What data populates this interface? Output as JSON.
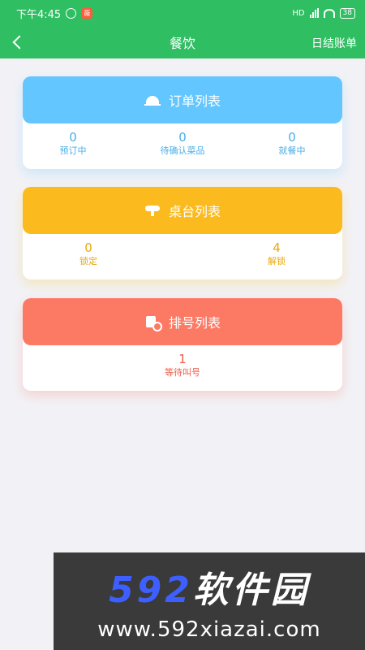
{
  "statusbar": {
    "time": "下午4:45",
    "app_badge": "薇",
    "network": "HD",
    "battery": "38"
  },
  "header": {
    "title": "餐饮",
    "right_action": "日结账单"
  },
  "cards": {
    "orders": {
      "title": "订单列表",
      "stats": [
        {
          "value": "0",
          "label": "预订中"
        },
        {
          "value": "0",
          "label": "待确认菜品"
        },
        {
          "value": "0",
          "label": "就餐中"
        }
      ]
    },
    "tables": {
      "title": "桌台列表",
      "stats": [
        {
          "value": "0",
          "label": "锁定"
        },
        {
          "value": "4",
          "label": "解锁"
        }
      ]
    },
    "queue": {
      "title": "排号列表",
      "stats": [
        {
          "value": "1",
          "label": "等待叫号"
        }
      ]
    }
  },
  "watermark": {
    "brand_num": "592",
    "brand_text": "软件园",
    "url": "www.592xiazai.com"
  },
  "colors": {
    "primary": "#2fbf62",
    "orders": "#63c6ff",
    "tables": "#fbbb1e",
    "queue": "#fc7a64"
  }
}
